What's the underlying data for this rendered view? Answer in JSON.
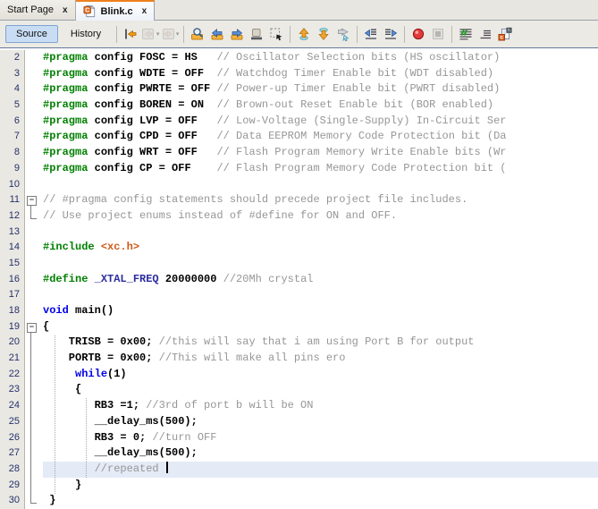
{
  "tabs": [
    {
      "label": "Start Page",
      "close": "x",
      "active": false
    },
    {
      "label": "Blink.c",
      "close": "x",
      "active": true,
      "icon": "c-file-icon"
    }
  ],
  "toolbar": {
    "source_label": "Source",
    "history_label": "History",
    "icon_groups": [
      [
        {
          "name": "jump-to-last-edit"
        },
        {
          "name": "back",
          "disabled": true,
          "caret": true
        },
        {
          "name": "forward",
          "disabled": true,
          "caret": true
        }
      ],
      [
        {
          "name": "find-selection"
        },
        {
          "name": "find-previous"
        },
        {
          "name": "find-next"
        },
        {
          "name": "toggle-highlight-search"
        },
        {
          "name": "rectangular-selection"
        }
      ],
      [
        {
          "name": "previous-bookmark"
        },
        {
          "name": "next-bookmark"
        },
        {
          "name": "toggle-bookmark"
        }
      ],
      [
        {
          "name": "shift-line-left"
        },
        {
          "name": "shift-line-right"
        }
      ],
      [
        {
          "name": "record-macro"
        },
        {
          "name": "stop-macro",
          "disabled": true
        }
      ],
      [
        {
          "name": "comment-lines"
        },
        {
          "name": "uncomment-lines"
        },
        {
          "name": "toggle-header-source"
        }
      ]
    ]
  },
  "editor": {
    "colors": {
      "preprocessor": "#008000",
      "keyword": "#0000e6",
      "comment": "#969696",
      "include_path": "#ce5b1c",
      "macro": "#2d2d9f",
      "text": "#000000",
      "current_line_bg": "#e4eaf6",
      "gutter_bg": "#e9e8e2",
      "line_number": "#25306b",
      "active_tab_accent": "#ee7f1c"
    },
    "caret_line": 28,
    "indent_guides": [
      {
        "col": 1.8,
        "from": 20,
        "to": 29
      },
      {
        "col": 6.7,
        "from": 24,
        "to": 28
      }
    ],
    "lines": [
      {
        "n": 2,
        "fold": "",
        "segs": [
          [
            "pp",
            "#pragma"
          ],
          [
            "code",
            " config FOSC = HS   "
          ],
          [
            "com",
            "// Oscillator Selection bits (HS oscillator)"
          ]
        ]
      },
      {
        "n": 3,
        "fold": "",
        "segs": [
          [
            "pp",
            "#pragma"
          ],
          [
            "code",
            " config WDTE = OFF  "
          ],
          [
            "com",
            "// Watchdog Timer Enable bit (WDT disabled)"
          ]
        ]
      },
      {
        "n": 4,
        "fold": "",
        "segs": [
          [
            "pp",
            "#pragma"
          ],
          [
            "code",
            " config PWRTE = OFF "
          ],
          [
            "com",
            "// Power-up Timer Enable bit (PWRT disabled)"
          ]
        ]
      },
      {
        "n": 5,
        "fold": "",
        "segs": [
          [
            "pp",
            "#pragma"
          ],
          [
            "code",
            " config BOREN = ON  "
          ],
          [
            "com",
            "// Brown-out Reset Enable bit (BOR enabled)"
          ]
        ]
      },
      {
        "n": 6,
        "fold": "",
        "segs": [
          [
            "pp",
            "#pragma"
          ],
          [
            "code",
            " config LVP = OFF   "
          ],
          [
            "com",
            "// Low-Voltage (Single-Supply) In-Circuit Ser"
          ]
        ]
      },
      {
        "n": 7,
        "fold": "",
        "segs": [
          [
            "pp",
            "#pragma"
          ],
          [
            "code",
            " config CPD = OFF   "
          ],
          [
            "com",
            "// Data EEPROM Memory Code Protection bit (Da"
          ]
        ]
      },
      {
        "n": 8,
        "fold": "",
        "segs": [
          [
            "pp",
            "#pragma"
          ],
          [
            "code",
            " config WRT = OFF   "
          ],
          [
            "com",
            "// Flash Program Memory Write Enable bits (Wr"
          ]
        ]
      },
      {
        "n": 9,
        "fold": "",
        "segs": [
          [
            "pp",
            "#pragma"
          ],
          [
            "code",
            " config CP = OFF    "
          ],
          [
            "com",
            "// Flash Program Memory Code Protection bit ("
          ]
        ]
      },
      {
        "n": 10,
        "fold": "",
        "segs": []
      },
      {
        "n": 11,
        "fold": "start",
        "segs": [
          [
            "com",
            "// #pragma config statements should precede project file includes."
          ]
        ]
      },
      {
        "n": 12,
        "fold": "end",
        "segs": [
          [
            "com",
            "// Use project enums instead of #define for ON and OFF."
          ]
        ]
      },
      {
        "n": 13,
        "fold": "",
        "segs": []
      },
      {
        "n": 14,
        "fold": "",
        "segs": [
          [
            "pp",
            "#include"
          ],
          [
            "code",
            " "
          ],
          [
            "inc",
            "<xc.h>"
          ]
        ]
      },
      {
        "n": 15,
        "fold": "",
        "segs": []
      },
      {
        "n": 16,
        "fold": "",
        "segs": [
          [
            "pp",
            "#define"
          ],
          [
            "code",
            " "
          ],
          [
            "mac",
            "_XTAL_FREQ"
          ],
          [
            "code",
            " 20000000 "
          ],
          [
            "com",
            "//20Mh crystal"
          ]
        ]
      },
      {
        "n": 17,
        "fold": "",
        "segs": []
      },
      {
        "n": 18,
        "fold": "",
        "segs": [
          [
            "kw",
            "void"
          ],
          [
            "code",
            " main()"
          ]
        ]
      },
      {
        "n": 19,
        "fold": "start",
        "segs": [
          [
            "code",
            "{"
          ]
        ]
      },
      {
        "n": 20,
        "fold": "mid",
        "segs": [
          [
            "code",
            "    TRISB = 0x00; "
          ],
          [
            "com",
            "//this will say that i am using Port B for output"
          ]
        ]
      },
      {
        "n": 21,
        "fold": "mid",
        "segs": [
          [
            "code",
            "    PORTB = 0x00; "
          ],
          [
            "com",
            "//This will make all pins ero"
          ]
        ]
      },
      {
        "n": 22,
        "fold": "mid",
        "segs": [
          [
            "code",
            "     "
          ],
          [
            "kw",
            "while"
          ],
          [
            "code",
            "(1)"
          ]
        ]
      },
      {
        "n": 23,
        "fold": "mid",
        "segs": [
          [
            "code",
            "     {"
          ]
        ]
      },
      {
        "n": 24,
        "fold": "mid",
        "segs": [
          [
            "code",
            "        RB3 =1; "
          ],
          [
            "com",
            "//3rd of port b will be ON"
          ]
        ]
      },
      {
        "n": 25,
        "fold": "mid",
        "segs": [
          [
            "code",
            "        "
          ],
          [
            "mac2",
            "__delay_ms"
          ],
          [
            "code",
            "(500);"
          ]
        ]
      },
      {
        "n": 26,
        "fold": "mid",
        "segs": [
          [
            "code",
            "        RB3 = 0; "
          ],
          [
            "com",
            "//turn OFF"
          ]
        ]
      },
      {
        "n": 27,
        "fold": "mid",
        "segs": [
          [
            "code",
            "        "
          ],
          [
            "mac2",
            "__delay_ms"
          ],
          [
            "code",
            "(500);"
          ]
        ]
      },
      {
        "n": 28,
        "fold": "mid",
        "current": true,
        "caret": true,
        "segs": [
          [
            "code",
            "        "
          ],
          [
            "com",
            "//repeated "
          ]
        ]
      },
      {
        "n": 29,
        "fold": "mid",
        "segs": [
          [
            "code",
            "     }"
          ]
        ]
      },
      {
        "n": 30,
        "fold": "end",
        "segs": [
          [
            "code",
            " }"
          ]
        ]
      }
    ]
  }
}
